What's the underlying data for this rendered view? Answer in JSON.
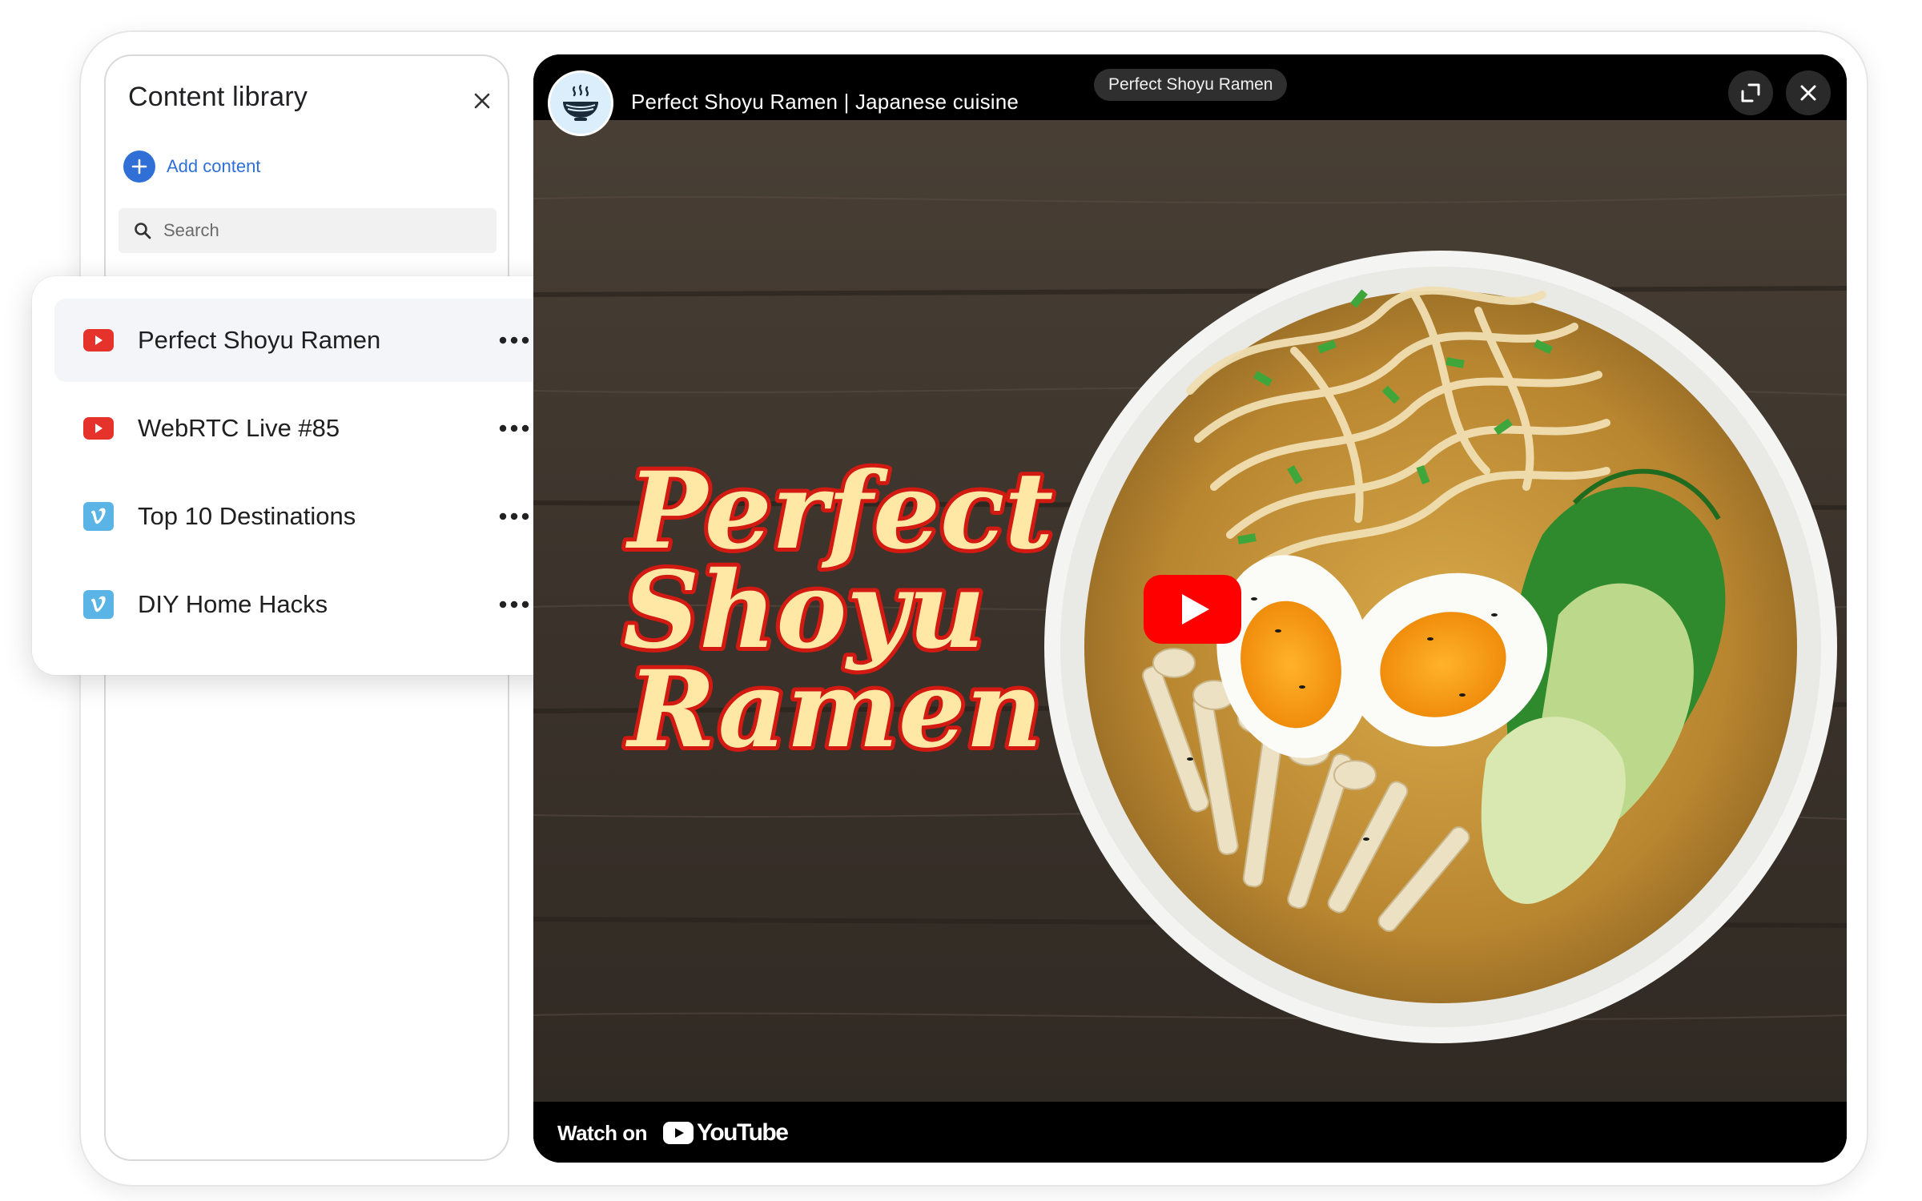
{
  "library": {
    "title": "Content library",
    "add_label": "Add content",
    "search_placeholder": "Search",
    "items": [
      {
        "label": "Perfect Shoyu Ramen",
        "source": "youtube",
        "selected": true
      },
      {
        "label": "WebRTC Live #85",
        "source": "youtube",
        "selected": false
      },
      {
        "label": "Top 10 Destinations",
        "source": "vimeo",
        "selected": false
      },
      {
        "label": "DIY Home Hacks",
        "source": "vimeo",
        "selected": false
      }
    ]
  },
  "player": {
    "video_title": "Perfect Shoyu Ramen | Japanese cuisine",
    "title_pill": "Perfect Shoyu Ramen",
    "thumbnail_text": [
      "Perfect",
      "Shoyu",
      "Ramen"
    ],
    "watch_on": "Watch on",
    "yt_brand": "YouTube"
  },
  "colors": {
    "accent_blue": "#2f6fd6",
    "youtube_red": "#e5322a",
    "vimeo_blue": "#5ab4e6",
    "thumb_text_fill": "#ffe7a6",
    "thumb_text_stroke": "#d21a12"
  },
  "icons": [
    "close-icon",
    "plus-icon",
    "search-icon",
    "youtube-icon",
    "vimeo-icon",
    "more-icon",
    "ramen-bowl-icon",
    "expand-icon",
    "play-icon"
  ]
}
